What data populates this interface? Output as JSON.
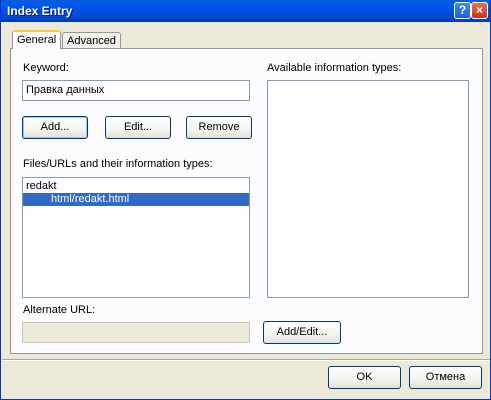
{
  "window": {
    "title": "Index Entry",
    "help_glyph": "?",
    "close_glyph": "×"
  },
  "tabs": [
    {
      "label": "General",
      "active": true
    },
    {
      "label": "Advanced",
      "active": false
    }
  ],
  "keyword": {
    "label": "Keyword:",
    "value": "Правка данных"
  },
  "keyword_buttons": {
    "add": "Add...",
    "edit": "Edit...",
    "remove": "Remove"
  },
  "files": {
    "label": "Files/URLs and their information types:",
    "items": [
      {
        "text": "redakt",
        "selected": false
      },
      {
        "text": "html/redakt.html",
        "selected": true
      }
    ]
  },
  "info_types": {
    "label": "Available information types:"
  },
  "alternate_url": {
    "label": "Alternate URL:",
    "value": "",
    "button": "Add/Edit..."
  },
  "dialog_buttons": {
    "ok": "OK",
    "cancel": "Отмена"
  },
  "colors": {
    "title_bar": "#0054E3",
    "selection": "#316AC5",
    "dialog_bg": "#ECE9D8"
  }
}
